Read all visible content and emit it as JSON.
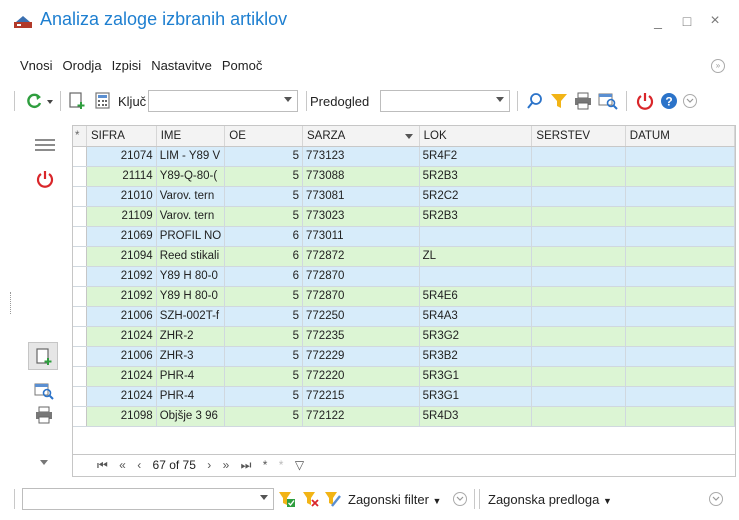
{
  "window": {
    "title": "Analiza zaloge izbranih artiklov",
    "minimize": "_",
    "maximize": "□",
    "close": "×"
  },
  "menu": [
    {
      "label": "Vnosi"
    },
    {
      "label": "Orodja"
    },
    {
      "label": "Izpisi"
    },
    {
      "label": "Nastavitve"
    },
    {
      "label": "Pomoč"
    }
  ],
  "toolbar": {
    "key_label": "Ključ",
    "key_value": "",
    "preview_label": "Predogled",
    "preview_value": ""
  },
  "grid": {
    "columns": [
      "SIFRA",
      "IME",
      "OE",
      "SARZA",
      "LOK",
      "SERSTEV",
      "DATUM"
    ],
    "new_row_marker": "*",
    "rows": [
      {
        "sifra": "21074",
        "ime": "LIM - Y89 V",
        "oe": "5",
        "sarza": "773123",
        "lok": "5R4F2",
        "serstev": "",
        "datum": ""
      },
      {
        "sifra": "21114",
        "ime": "Y89-Q-80-(",
        "oe": "5",
        "sarza": "773088",
        "lok": "5R2B3",
        "serstev": "",
        "datum": ""
      },
      {
        "sifra": "21010",
        "ime": "Varov. tern",
        "oe": "5",
        "sarza": "773081",
        "lok": "5R2C2",
        "serstev": "",
        "datum": ""
      },
      {
        "sifra": "21109",
        "ime": "Varov. tern",
        "oe": "5",
        "sarza": "773023",
        "lok": "5R2B3",
        "serstev": "",
        "datum": ""
      },
      {
        "sifra": "21069",
        "ime": "PROFIL NO",
        "oe": "6",
        "sarza": "773011",
        "lok": "",
        "serstev": "",
        "datum": ""
      },
      {
        "sifra": "21094",
        "ime": "Reed stikali",
        "oe": "6",
        "sarza": "772872",
        "lok": "ZL",
        "serstev": "",
        "datum": ""
      },
      {
        "sifra": "21092",
        "ime": "Y89 H 80-0",
        "oe": "6",
        "sarza": "772870",
        "lok": "",
        "serstev": "",
        "datum": ""
      },
      {
        "sifra": "21092",
        "ime": "Y89 H 80-0",
        "oe": "5",
        "sarza": "772870",
        "lok": "5R4E6",
        "serstev": "",
        "datum": ""
      },
      {
        "sifra": "21006",
        "ime": "SZH-002T-f",
        "oe": "5",
        "sarza": "772250",
        "lok": "5R4A3",
        "serstev": "",
        "datum": ""
      },
      {
        "sifra": "21024",
        "ime": "ZHR-2",
        "oe": "5",
        "sarza": "772235",
        "lok": "5R3G2",
        "serstev": "",
        "datum": ""
      },
      {
        "sifra": "21006",
        "ime": "ZHR-3",
        "oe": "5",
        "sarza": "772229",
        "lok": "5R3B2",
        "serstev": "",
        "datum": ""
      },
      {
        "sifra": "21024",
        "ime": "PHR-4",
        "oe": "5",
        "sarza": "772220",
        "lok": "5R3G1",
        "serstev": "",
        "datum": ""
      },
      {
        "sifra": "21024",
        "ime": "PHR-4",
        "oe": "5",
        "sarza": "772215",
        "lok": "5R3G1",
        "serstev": "",
        "datum": ""
      },
      {
        "sifra": "21098",
        "ime": "Objšje 3 96",
        "oe": "5",
        "sarza": "772122",
        "lok": "5R4D3",
        "serstev": "",
        "datum": ""
      }
    ],
    "navigator": {
      "position": "67 of 75"
    }
  },
  "bottom": {
    "filter_value": "",
    "filter_label": "Zagonski filter",
    "template_label": "Zagonska predloga"
  },
  "colors": {
    "title": "#1e7fd0",
    "row_blue": "#d7ecfa",
    "row_green": "#dcf5d4",
    "refresh": "#2e9e3e",
    "power": "#d9262a",
    "help": "#2b73c9",
    "filter": "#f2b416"
  }
}
